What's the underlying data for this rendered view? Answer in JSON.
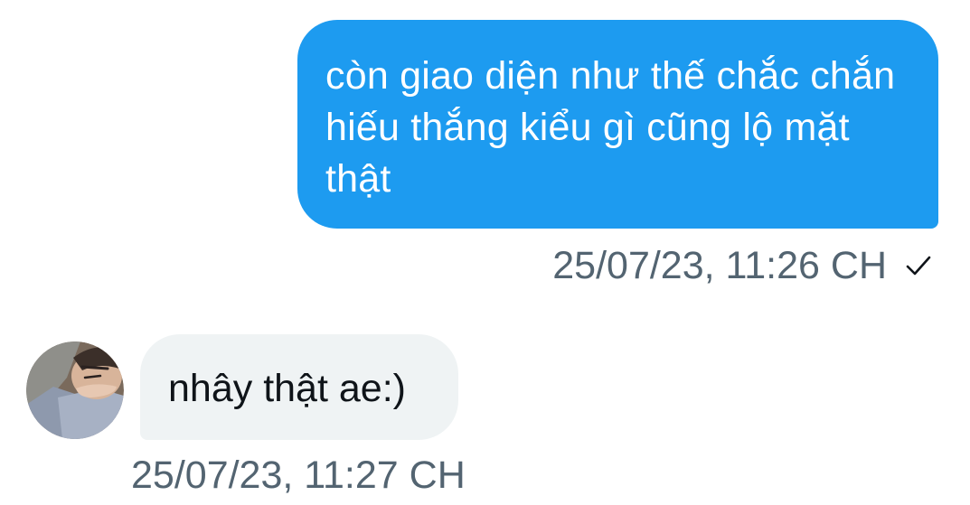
{
  "colors": {
    "sent_bubble": "#1d9bf0",
    "received_bubble": "#eff3f4",
    "timestamp_text": "#536471",
    "message_text_dark": "#0f1419"
  },
  "messages": {
    "sent": {
      "text": "còn giao diện như thế chắc chắn hiếu thắng kiểu gì cũng lộ mặt thật",
      "timestamp": "25/07/23, 11:26 CH",
      "status_icon": "checkmark-icon"
    },
    "received": {
      "text": "nhây thật ae:)",
      "timestamp": "25/07/23, 11:27 CH",
      "avatar_icon": "user-avatar"
    }
  }
}
